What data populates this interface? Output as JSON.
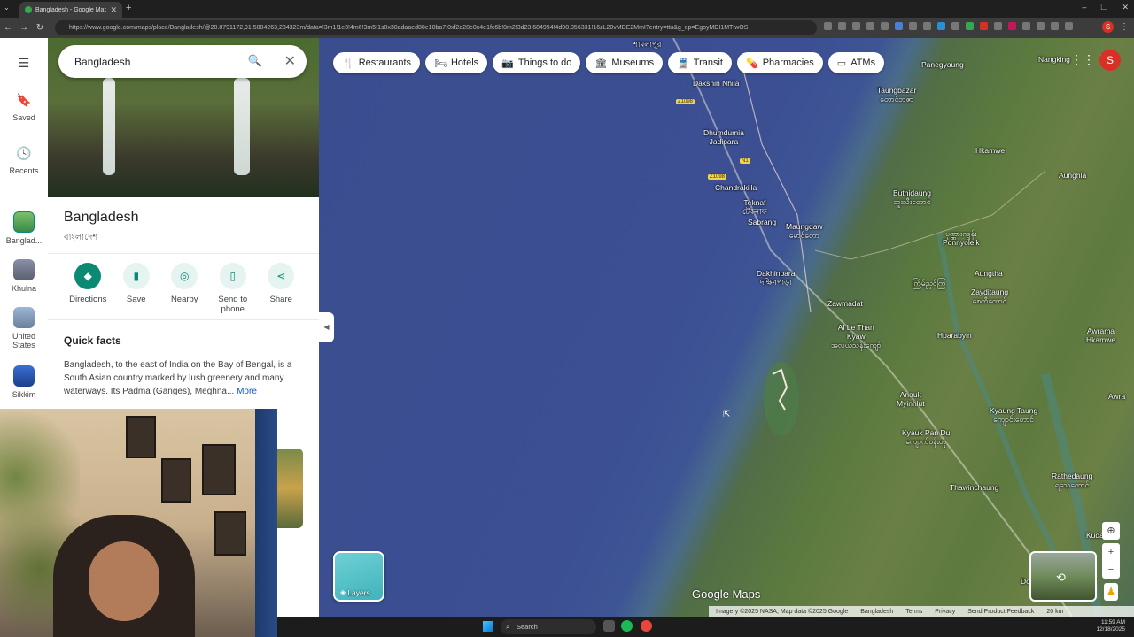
{
  "browser": {
    "tab_title": "Bangladesh - Google Maps",
    "url": "https://www.google.com/maps/place/Bangladesh/@20.8791172,91.5084263,234323m/data=!3m1!1e3!4m6!3m5!1s0x30adaaed80e18ba7:0xf2d28e0c4e1fc6b!8m2!3d23.684994!4d90.356331!16zL20vMDE2MmI?entry=ttu&g_ep=EgoyMDI1MTIwOS",
    "profile_initial": "S"
  },
  "rail": {
    "saved": "Saved",
    "recents": "Recents",
    "items": [
      "Banglad...",
      "Khulna",
      "United States",
      "Sikkim"
    ]
  },
  "search": {
    "value": "Bangladesh"
  },
  "place": {
    "title": "Bangladesh",
    "subtitle": "বাংলাদেশ",
    "actions": [
      "Directions",
      "Save",
      "Nearby",
      "Send to phone",
      "Share"
    ],
    "quick_facts_title": "Quick facts",
    "quick_facts_text": "Bangladesh, to the east of India on the Bay of Bengal, is a South Asian country marked by lush greenery and many waterways. Its Padma (Ganges), Meghna...",
    "more": "More"
  },
  "filters": [
    "Restaurants",
    "Hotels",
    "Things to do",
    "Museums",
    "Transit",
    "Pharmacies",
    "ATMs"
  ],
  "map": {
    "labels": {
      "shamlapur": "শামলাপুর",
      "dakshin_nhila": "Dakshin Nhila",
      "dhumdumia": "Dhumdumia\nJadipara",
      "chandrakilla": "Chandrakilla",
      "teknaf": "Teknaf\nটেকনাফ",
      "sabrang": "Sabrang",
      "maungdaw": "Maungdaw\nမောင်တော",
      "dakhinpara": "Dakhinpara\nদক্ষিণপাড়া",
      "zawmadat": "Zawmadat",
      "al_le_than_kyaw": "Al Le Than\nKyaw\nအလယ်သန်းကျော်",
      "anauk_myinhlut": "Anauk\nMyinhlut",
      "kyauk_pan_du": "Kyauk Pan Du\nကျောက်ပန်းတူ",
      "thawinchaung": "Thawinchaung",
      "panegyaung": "Panegyaung",
      "nangking": "Nangking",
      "taungbazar": "Taungbazar\nတောင်ဘဇာ",
      "hkamwe": "Hkamwe",
      "aunghla": "Aunghla",
      "buthidaung": "Buthidaung\nဘူးသီးတောင်",
      "ponnyoleik": "ပုဏ္ဏားကျွန်း\nPonnyoleik",
      "aungtha": "Aungtha",
      "zayditaung": "Zayditaung\nစေတီတောင်",
      "kyein_nyin_kya": "ကြိမ်ညှင်ကြ",
      "hparabyin": "Hparabyin",
      "awrama": "Awrama\nHkamwe",
      "kyaung_taung": "Kyaung Taung\nကျောင်းတောင်",
      "rathedaung": "Rathedaung\nရသေ့တောင်",
      "kudaung": "Kudaun",
      "donbaik": "Donb",
      "awra": "Awra"
    },
    "road_shields": [
      "Z1098",
      "Z1098",
      "N1"
    ],
    "brand": "Google Maps",
    "layers": "Layers",
    "attribution": [
      "Imagery ©2025 NASA, Map data ©2025 Google",
      "Bangladesh",
      "Terms",
      "Privacy",
      "Send Product Feedback",
      "20 km"
    ]
  },
  "taskbar": {
    "search": "Search",
    "time": "11:59 AM",
    "date": "12/18/2025"
  }
}
